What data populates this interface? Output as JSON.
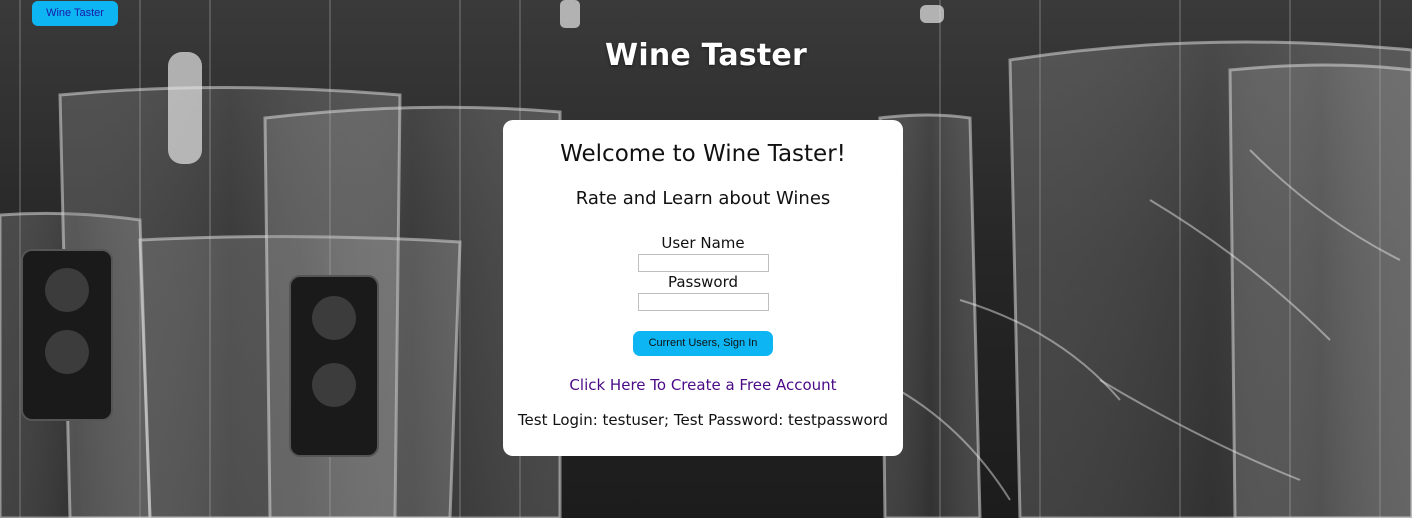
{
  "nav": {
    "brand_button": "Wine Taster"
  },
  "header": {
    "title": "Wine Taster"
  },
  "login_card": {
    "heading": "Welcome to Wine Taster!",
    "subheading": "Rate and Learn about Wines",
    "username_label": "User Name",
    "username_value": "",
    "password_label": "Password",
    "password_value": "",
    "signin_button": "Current Users, Sign In",
    "create_account_link": "Click Here To Create a Free Account",
    "test_credentials": "Test Login: testuser; Test Password: testpassword"
  },
  "colors": {
    "accent": "#0db5f3",
    "link": "#4b0a86",
    "card_bg": "#ffffff"
  },
  "background": {
    "image": "wine-glasses-photo"
  }
}
